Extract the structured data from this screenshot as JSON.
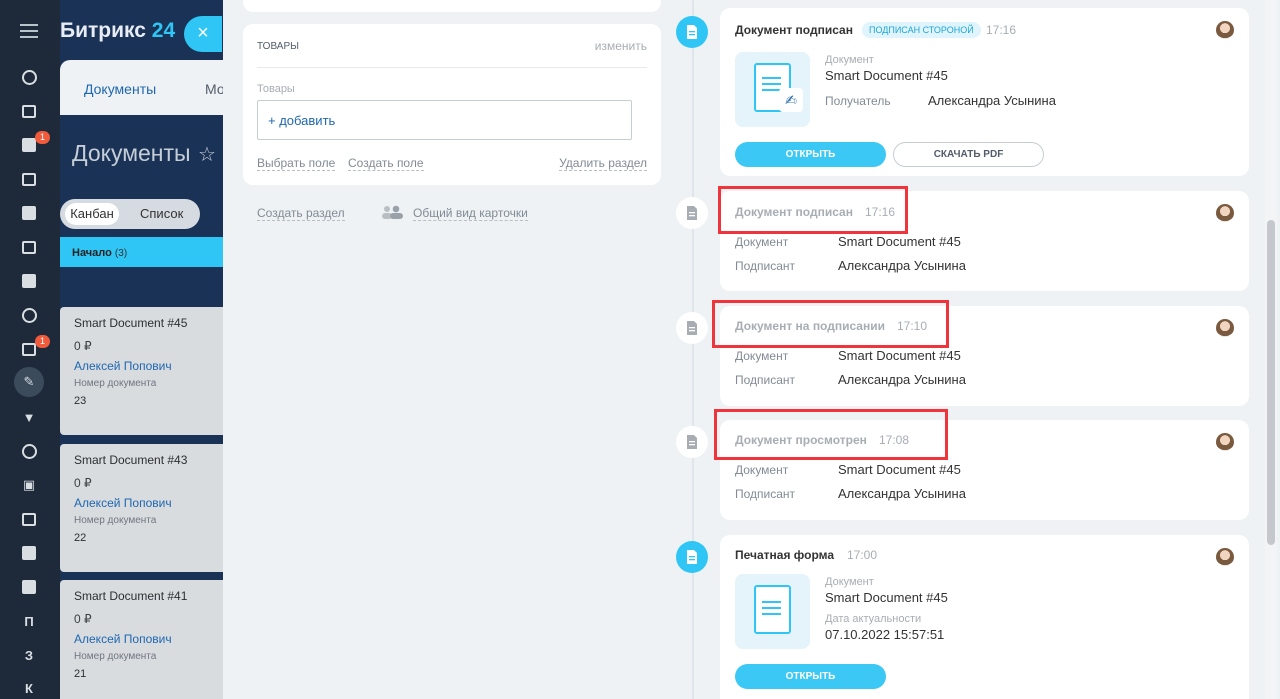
{
  "brand": {
    "name": "Битрикс",
    "num": "24"
  },
  "nav": {
    "badges": [
      "1",
      "1"
    ],
    "letters": [
      "П",
      "З",
      "К"
    ]
  },
  "background": {
    "tabs": [
      "Документы",
      "Мо"
    ],
    "title": "Документы",
    "views": [
      "Канбан",
      "Список"
    ],
    "column": {
      "name": "Начало",
      "count": "(3)"
    },
    "cards": [
      {
        "title": "Smart Document #45",
        "price": "0 ₽",
        "person": "Алексей Попович",
        "label": "Номер документа",
        "value": "23"
      },
      {
        "title": "Smart Document #43",
        "price": "0 ₽",
        "person": "Алексей Попович",
        "label": "Номер документа",
        "value": "22"
      },
      {
        "title": "Smart Document #41",
        "price": "0 ₽",
        "person": "Алексей Попович",
        "label": "Номер документа",
        "value": "21"
      }
    ]
  },
  "goods": {
    "header": "ТОВАРЫ",
    "edit": "изменить",
    "sub": "Товары",
    "add": "+ добавить",
    "select_field": "Выбрать поле",
    "create_field": "Создать поле",
    "delete_section": "Удалить раздел"
  },
  "sections": {
    "create": "Создать раздел",
    "common_view": "Общий вид карточки"
  },
  "timeline": {
    "signed_card": {
      "title": "Документ подписан",
      "tag": "подписан стороной",
      "time": "17:16",
      "doc_label": "Документ",
      "doc_value": "Smart Document #45",
      "recipient_label": "Получатель",
      "recipient_value": "Александра Усынина",
      "open": "ОТКРЫТЬ",
      "pdf": "СКАЧАТЬ PDF"
    },
    "events": [
      {
        "title": "Документ подписан",
        "time": "17:16",
        "doc_label": "Документ",
        "doc_value": "Smart Document #45",
        "signer_label": "Подписант",
        "signer_value": "Александра Усынина"
      },
      {
        "title": "Документ на подписании",
        "time": "17:10",
        "doc_label": "Документ",
        "doc_value": "Smart Document #45",
        "signer_label": "Подписант",
        "signer_value": "Александра Усынина"
      },
      {
        "title": "Документ просмотрен",
        "time": "17:08",
        "doc_label": "Документ",
        "doc_value": "Smart Document #45",
        "signer_label": "Подписант",
        "signer_value": "Александра Усынина"
      }
    ],
    "print_card": {
      "title": "Печатная форма",
      "time": "17:00",
      "doc_label": "Документ",
      "doc_value": "Smart Document #45",
      "date_label": "Дата актуальности",
      "date_value": "07.10.2022 15:57:51",
      "open": "ОТКРЫТЬ"
    }
  },
  "colors": {
    "accent": "#2fc6f6",
    "highlight": "#f0343c",
    "sidebar": "#1e2a3a"
  }
}
